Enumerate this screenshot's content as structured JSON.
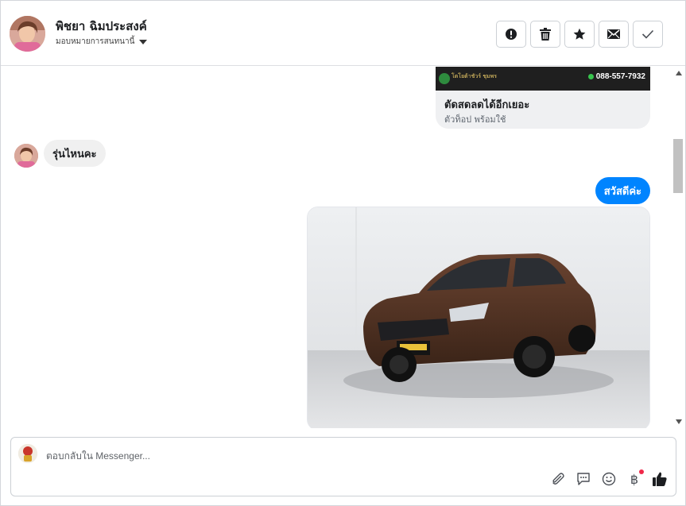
{
  "header": {
    "contact_name": "พิชยา ฉิมประสงค์",
    "assign_label": "มอบหมายการสนทนานี้",
    "actions": [
      {
        "name": "mark-spam-button",
        "icon": "alert-circle-icon"
      },
      {
        "name": "delete-button",
        "icon": "trash-icon"
      },
      {
        "name": "star-button",
        "icon": "star-icon"
      },
      {
        "name": "mark-unread-button",
        "icon": "envelope-icon"
      },
      {
        "name": "mark-done-button",
        "icon": "check-icon"
      }
    ]
  },
  "ad": {
    "brand_text": "โตโยต้าชัวร์ ชุมพร",
    "phone": "088-557-7932",
    "title": "ตัดสดลดได้อีกเยอะ",
    "subtitle": "ตัวท็อป พร้อมใช้"
  },
  "messages": {
    "incoming_text": "รุ่นไหนคะ",
    "outgoing_text": "สวัสดีค่ะ"
  },
  "composer": {
    "placeholder": "ตอบกลับใน Messenger..."
  },
  "colors": {
    "accent": "#0084ff",
    "notification_dot": "#f02849"
  }
}
